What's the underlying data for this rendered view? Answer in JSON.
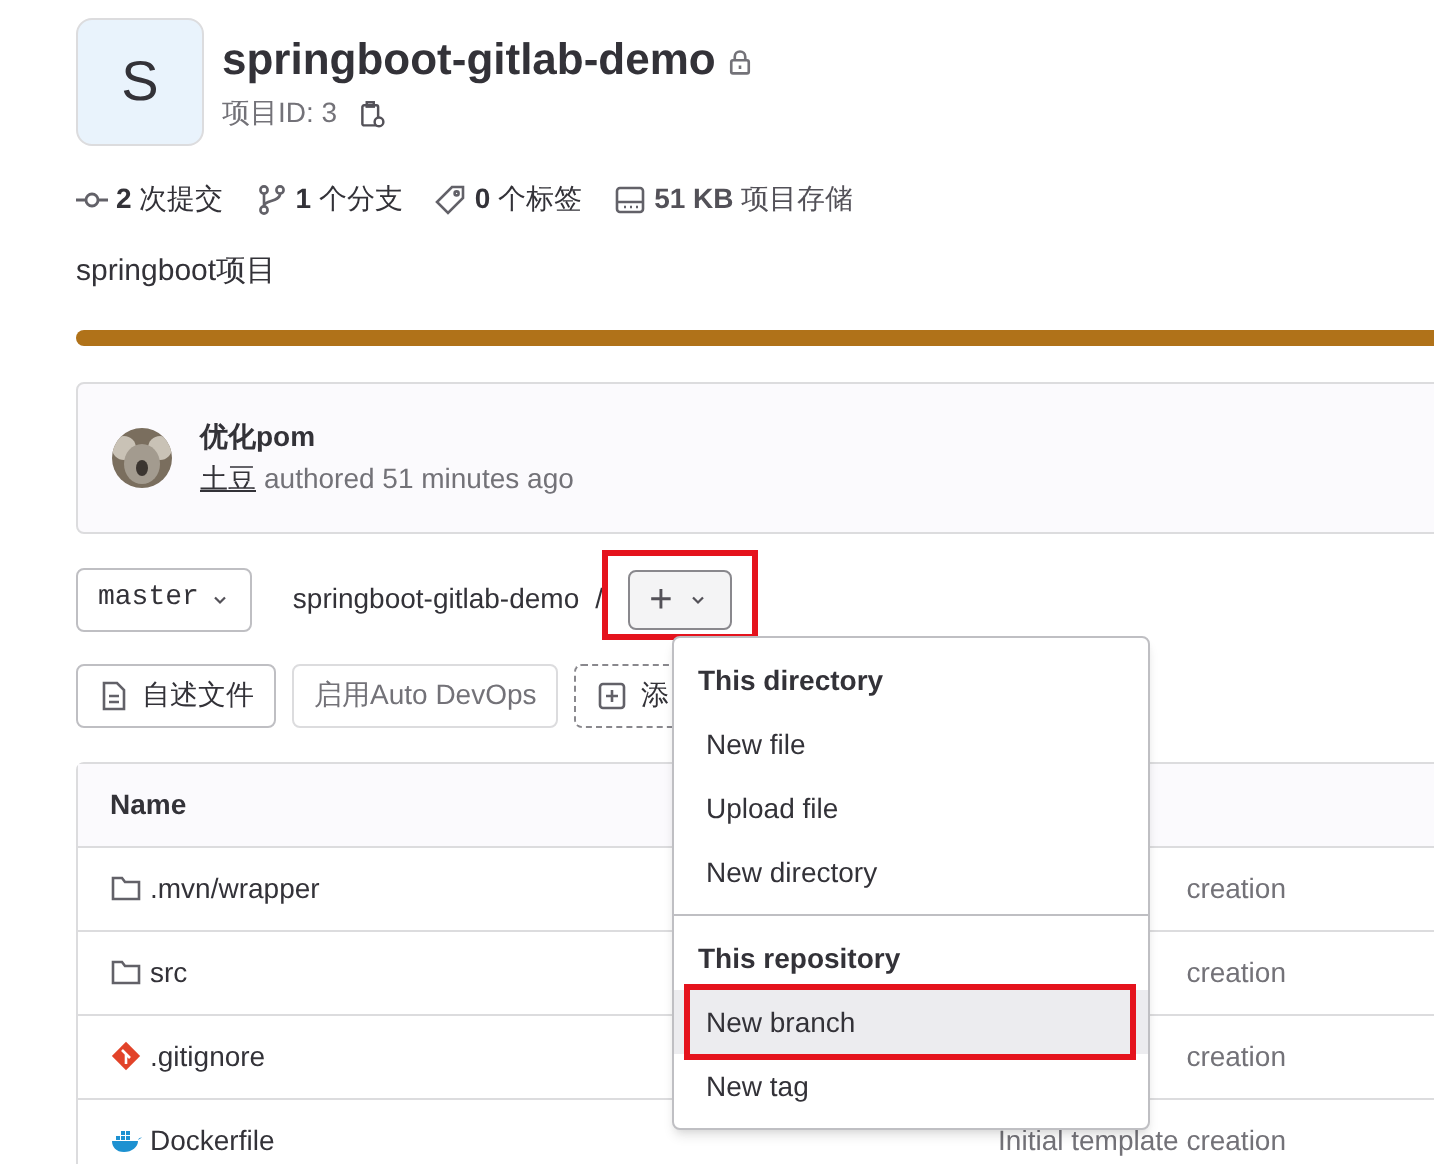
{
  "project": {
    "avatar_letter": "S",
    "name": "springboot-gitlab-demo",
    "private": true,
    "id_label": "项目ID: 3"
  },
  "stats": [
    {
      "kind": "commit",
      "value": "2",
      "label": "次提交"
    },
    {
      "kind": "branch",
      "value": "1",
      "label": "个分支"
    },
    {
      "kind": "tag",
      "value": "0",
      "label": "个标签"
    },
    {
      "kind": "storage",
      "value": "51 KB",
      "label": "项目存储"
    }
  ],
  "description": "springboot项目",
  "language_bar": {
    "color": "#b07219"
  },
  "last_commit": {
    "title": "优化pom",
    "author": "土豆",
    "meta": "authored 51 minutes ago"
  },
  "branch_selector": {
    "value": "master"
  },
  "breadcrumb": {
    "path": "springboot-gitlab-demo",
    "separator": "/",
    "add_button": {
      "symbol": "+",
      "expanded": true,
      "highlighted": true
    }
  },
  "actions": [
    {
      "kind": "readme",
      "label": "自述文件"
    },
    {
      "kind": "plain",
      "label": "启用Auto DevOps"
    },
    {
      "kind": "add",
      "label": "添"
    }
  ],
  "table": {
    "columns": [
      "Name"
    ],
    "rows": [
      {
        "kind": "folder",
        "name": ".mvn/wrapper",
        "last_commit": "creation"
      },
      {
        "kind": "folder",
        "name": "src",
        "last_commit": "creation"
      },
      {
        "kind": "git",
        "name": ".gitignore",
        "last_commit": "creation"
      },
      {
        "kind": "docker",
        "name": "Dockerfile",
        "last_commit": "Initial template creation"
      }
    ]
  },
  "dropdown": {
    "sections": [
      {
        "header": "This directory",
        "items": [
          {
            "label": "New file",
            "selected": false,
            "highlighted": false
          },
          {
            "label": "Upload file",
            "selected": false,
            "highlighted": false
          },
          {
            "label": "New directory",
            "selected": false,
            "highlighted": false
          }
        ]
      },
      {
        "header": "This repository",
        "items": [
          {
            "label": "New branch",
            "selected": true,
            "highlighted": true
          },
          {
            "label": "New tag",
            "selected": false,
            "highlighted": false
          }
        ]
      }
    ]
  }
}
